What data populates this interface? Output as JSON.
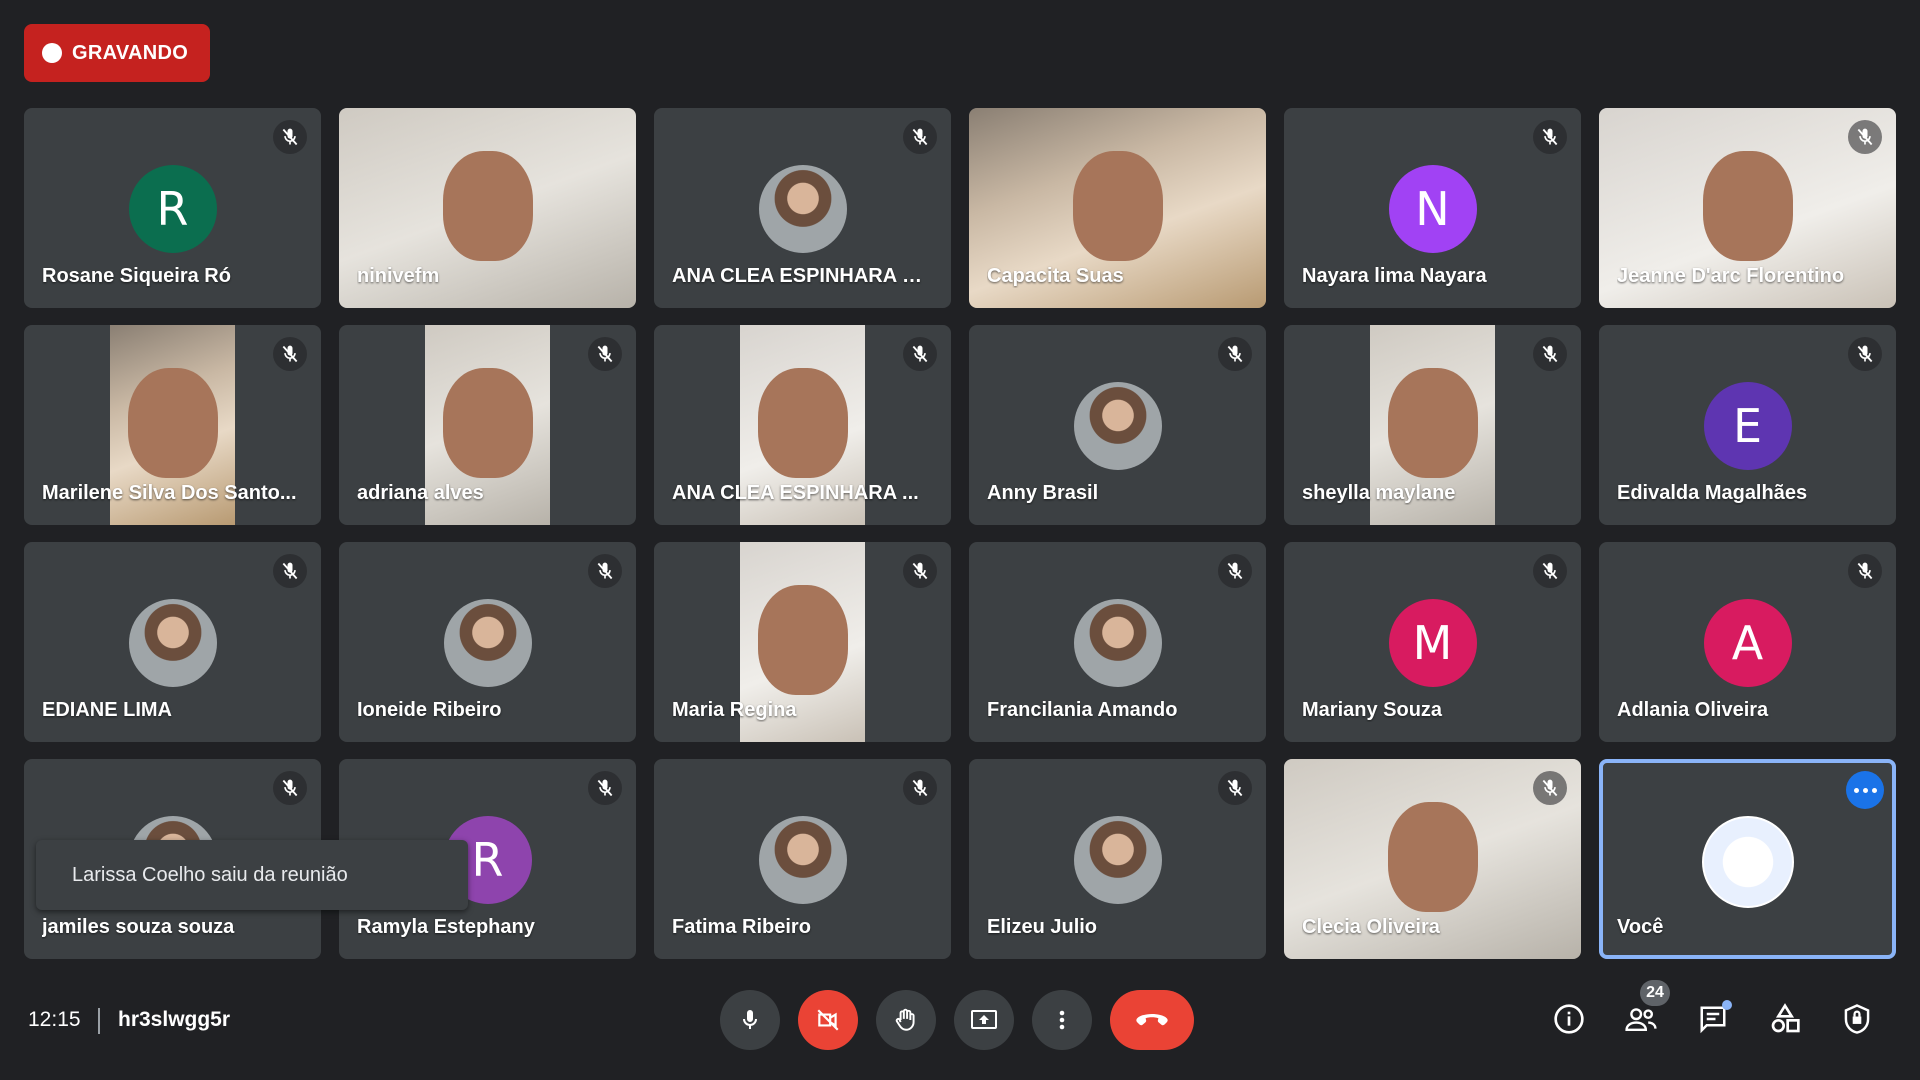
{
  "recording": {
    "label": "GRAVANDO",
    "color": "#c5221f"
  },
  "participants": [
    {
      "name": "Rosane Siqueira Ró",
      "avatar_letter": "R",
      "avatar_color": "#0b6e4f",
      "muted": true
    },
    {
      "name": "ninivefm",
      "muted": false,
      "video": true
    },
    {
      "name": "ANA CLEA ESPINHARA D...",
      "muted": true,
      "avatar_photo": true
    },
    {
      "name": "Capacita Suas",
      "muted": false,
      "video": true
    },
    {
      "name": "Nayara lima Nayara",
      "avatar_letter": "N",
      "avatar_color": "#a142f4",
      "muted": true
    },
    {
      "name": "Jeanne D'arc Florentino",
      "muted": true,
      "video": true
    },
    {
      "name": "Marilene Silva Dos Santo...",
      "muted": true,
      "video": true
    },
    {
      "name": "adriana alves",
      "muted": true,
      "video": true
    },
    {
      "name": "ANA CLEA ESPINHARA ...",
      "muted": true,
      "video": true
    },
    {
      "name": "Anny Brasil",
      "muted": true,
      "avatar_photo": true
    },
    {
      "name": "sheylla maylane",
      "muted": true,
      "video": true
    },
    {
      "name": "Edivalda Magalhães",
      "avatar_letter": "E",
      "avatar_color": "#5e35b1",
      "muted": true
    },
    {
      "name": "EDIANE LIMA",
      "muted": true,
      "avatar_photo": true
    },
    {
      "name": "Ioneide Ribeiro",
      "muted": true,
      "avatar_photo": true
    },
    {
      "name": "Maria Regina",
      "muted": true,
      "video": true
    },
    {
      "name": "Francilania Amando",
      "muted": true,
      "avatar_photo": true
    },
    {
      "name": "Mariany Souza",
      "avatar_letter": "M",
      "avatar_color": "#d81b60",
      "muted": true
    },
    {
      "name": "Adlania Oliveira",
      "avatar_letter": "A",
      "avatar_color": "#d81b60",
      "muted": true
    },
    {
      "name": "jamiles souza souza",
      "muted": true,
      "avatar_photo": true
    },
    {
      "name": "Ramyla Estephany",
      "avatar_letter": "R",
      "avatar_color": "#8e44ad",
      "muted": true
    },
    {
      "name": "Fatima Ribeiro",
      "muted": true,
      "avatar_photo": true
    },
    {
      "name": "Elizeu Julio",
      "muted": true,
      "avatar_photo": true
    },
    {
      "name": "Clecia Oliveira",
      "muted": true,
      "video": true
    },
    {
      "name": "Você",
      "muted": false,
      "avatar_photo": true,
      "self": true
    }
  ],
  "toast": {
    "text": "Larissa Coelho saiu da reunião"
  },
  "footer": {
    "time": "12:15",
    "meeting_code": "hr3slwgg5r",
    "participant_count": "24"
  },
  "icons": {
    "mic": "mic-icon",
    "camera_off": "camera-off-icon",
    "hand": "raise-hand-icon",
    "present": "present-screen-icon",
    "more": "more-options-icon",
    "hangup": "hang-up-icon",
    "info": "info-icon",
    "people": "people-icon",
    "chat": "chat-icon",
    "activities": "activities-icon",
    "host": "host-controls-icon"
  }
}
